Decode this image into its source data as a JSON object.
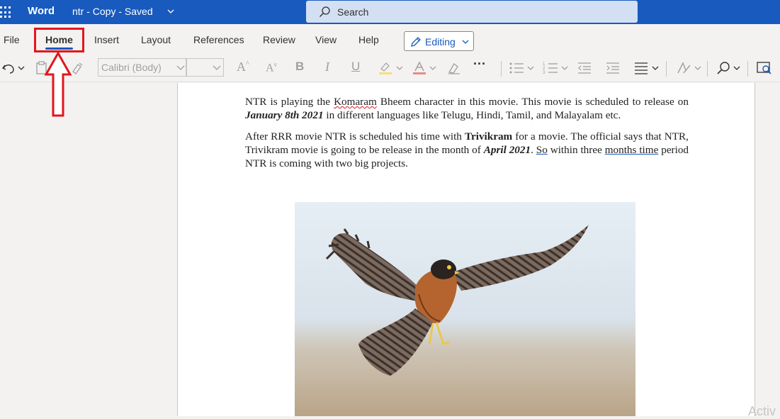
{
  "titlebar": {
    "app_name": "Word",
    "doc_title": "ntr - Copy  -  Saved",
    "search_placeholder": "Search"
  },
  "ribbon": {
    "tabs": [
      "File",
      "Home",
      "Insert",
      "Layout",
      "References",
      "Review",
      "View",
      "Help"
    ],
    "active_tab": "Home",
    "editing_label": "Editing"
  },
  "toolbar": {
    "font_name": "Calibri (Body)",
    "font_size": "",
    "icons": [
      "undo-icon",
      "paste-icon",
      "format-painter-icon",
      "grow-font-icon",
      "shrink-font-icon",
      "bold-icon",
      "italic-icon",
      "underline-icon",
      "highlight-icon",
      "font-color-icon",
      "clear-format-icon",
      "more-icon",
      "bullets-icon",
      "numbering-icon",
      "decrease-indent-icon",
      "increase-indent-icon",
      "align-icon",
      "styles-icon",
      "find-icon",
      "editor-icon"
    ]
  },
  "document": {
    "p1": {
      "s1": "NTR is playing the ",
      "s2": "Komaram",
      "s3": " Bheem character in this movie. This movie is scheduled to release on ",
      "s4": "January 8th 2021",
      "s5": " in different languages like Telugu, Hindi, Tamil, and Malayalam etc."
    },
    "p2": {
      "s1": "After RRR movie NTR is scheduled his time with ",
      "s2": "Trivikram",
      "s3": " for a movie. The official says that NTR, Trivikram movie is going to be release in the month of ",
      "s4": "April 2021",
      "s5": ". ",
      "s6": "So",
      "s7": " within three ",
      "s8": "months time",
      "s9": " period NTR is coming with two big projects."
    }
  },
  "watermark": "Activ",
  "colors": {
    "titlebar": "#185abd",
    "annotation_red": "#e3161c",
    "ribbon_bg": "#f3f2f1"
  }
}
